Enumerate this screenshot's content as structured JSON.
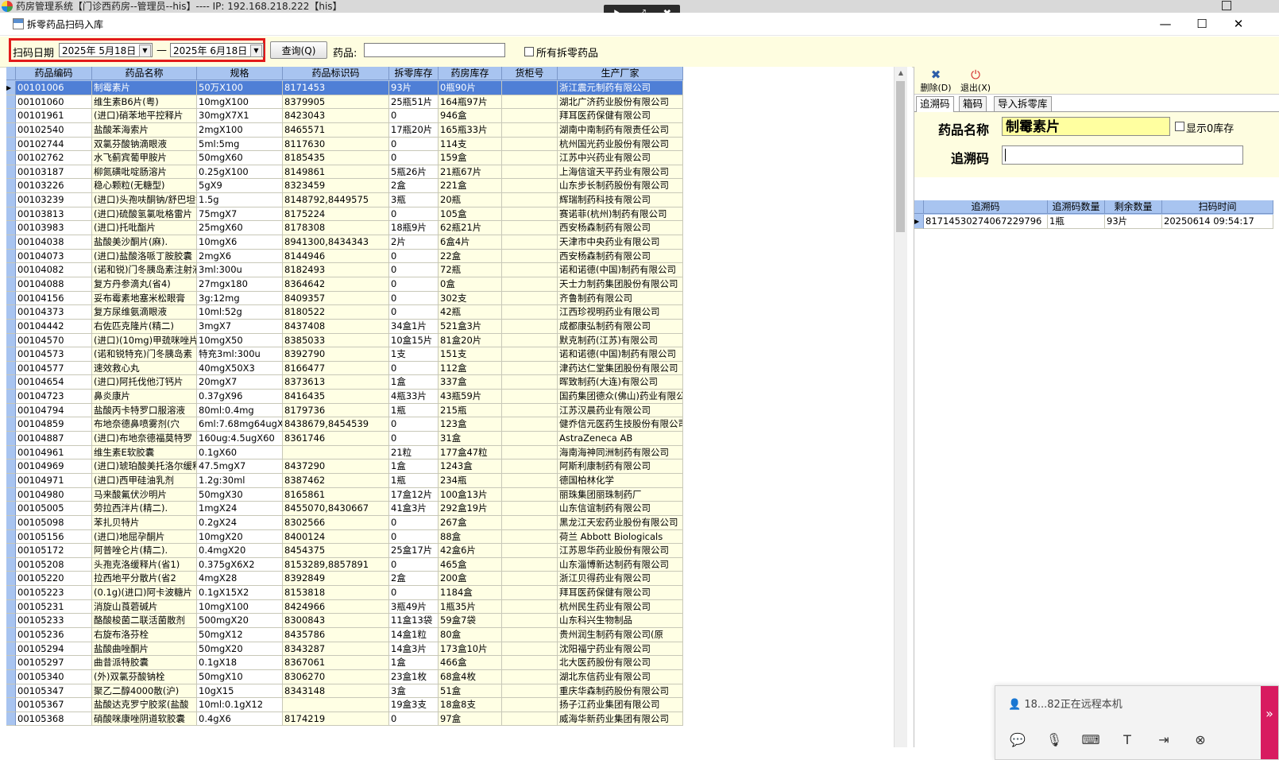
{
  "app": {
    "bg_title": "药房管理系统【门诊西药房--管理员--his】---- IP: 192.168.218.222【his】",
    "window_title": "拆零药品扫码入库",
    "controls": {
      "minimize": "—",
      "maximize": "☐",
      "close": "✕"
    }
  },
  "remote_toolbar": [
    "⯈",
    "⤢",
    "✖"
  ],
  "toolbar": {
    "scan_date_label": "扫码日期",
    "date_from": "2025年 5月18日",
    "dash": "—",
    "date_to": "2025年 6月18日",
    "query_button": "查询(Q)",
    "drug_label": "药品:",
    "drug_value": "",
    "all_split_label": "所有拆零药品"
  },
  "grid": {
    "columns": [
      "药品编码",
      "药品名称",
      "规格",
      "药品标识码",
      "拆零库存",
      "药房库存",
      "货柜号",
      "生产厂家"
    ],
    "rows": [
      [
        "00101006",
        "制霉素片",
        "50万X100",
        "8171453",
        "93片",
        "0瓶90片",
        "",
        "浙江震元制药有限公司"
      ],
      [
        "00101060",
        "维生素B6片(粤)",
        "10mgX100",
        "8379905",
        "25瓶51片",
        "164瓶97片",
        "",
        "湖北广济药业股份有限公司"
      ],
      [
        "00101961",
        "(进口)硝苯地平控释片",
        "30mgX7X1",
        "8423043",
        "0",
        "946盒",
        "",
        "拜耳医药保健有限公司"
      ],
      [
        "00102540",
        "盐酸苯海索片",
        "2mgX100",
        "8465571",
        "17瓶20片",
        "165瓶33片",
        "",
        "湖南中南制药有限责任公司"
      ],
      [
        "00102744",
        "双氯芬酸钠滴眼液",
        "5ml:5mg",
        "8117630",
        "0",
        "114支",
        "",
        "杭州国光药业股份有限公司"
      ],
      [
        "00102762",
        "水飞蓟宾葡甲胺片",
        "50mgX60",
        "8185435",
        "0",
        "159盒",
        "",
        "江苏中兴药业有限公司"
      ],
      [
        "00103187",
        "柳氮磺吡啶肠溶片",
        "0.25gX100",
        "8149861",
        "5瓶26片",
        "21瓶67片",
        "",
        "上海信谊天平药业有限公司"
      ],
      [
        "00103226",
        "稳心颗粒(无糖型)",
        "5gX9",
        "8323459",
        "2盒",
        "221盒",
        "",
        "山东步长制药股份有限公司"
      ],
      [
        "00103239",
        "(进口)头孢呋酮钠/舒巴坦钠",
        "1.5g",
        "8148792,8449575",
        "3瓶",
        "20瓶",
        "",
        "辉瑞制药科技有限公司"
      ],
      [
        "00103813",
        "(进口)硫酸氢氯吡格雷片",
        "75mgX7",
        "8175224",
        "0",
        "105盒",
        "",
        "赛诺菲(杭州)制药有限公司"
      ],
      [
        "00103983",
        "(进口)托吡酯片",
        "25mgX60",
        "8178308",
        "18瓶9片",
        "62瓶21片",
        "",
        "西安杨森制药有限公司"
      ],
      [
        "00104038",
        "盐酸美沙酮片(麻).",
        "10mgX6",
        "8941300,8434343",
        "2片",
        "6盒4片",
        "",
        "天津市中央药业有限公司"
      ],
      [
        "00104073",
        "(进口)盐酸洛哌丁胺胶囊",
        "2mgX6",
        "8144946",
        "0",
        "22盒",
        "",
        "西安杨森制药有限公司"
      ],
      [
        "00104082",
        "(诺和锐)门冬胰岛素注射液",
        "3ml:300u",
        "8182493",
        "0",
        "72瓶",
        "",
        "诺和诺德(中国)制药有限公司"
      ],
      [
        "00104088",
        "复方丹参滴丸(省4)",
        "27mgx180",
        "8364642",
        "0",
        "0盒",
        "",
        "天士力制药集团股份有限公司"
      ],
      [
        "00104156",
        "妥布霉素地塞米松眼膏",
        "3g:12mg",
        "8409357",
        "0",
        "302支",
        "",
        "齐鲁制药有限公司"
      ],
      [
        "00104373",
        "复方尿维氨滴眼液",
        "10ml:52g",
        "8180522",
        "0",
        "42瓶",
        "",
        "江西珍视明药业有限公司"
      ],
      [
        "00104442",
        "右佐匹克隆片(精二)",
        "3mgX7",
        "8437408",
        "34盒1片",
        "521盒3片",
        "",
        "成都康弘制药有限公司"
      ],
      [
        "00104570",
        "(进口)(10mg)甲巯咪唑片",
        "10mgX50",
        "8385033",
        "10盒15片",
        "81盒20片",
        "",
        "默克制药(江苏)有限公司"
      ],
      [
        "00104573",
        "(诺和锐特充)门冬胰岛素",
        "特充3ml:300u",
        "8392790",
        "1支",
        "151支",
        "",
        "诺和诺德(中国)制药有限公司"
      ],
      [
        "00104577",
        "速效救心丸",
        "40mgX50X3",
        "8166477",
        "0",
        "112盒",
        "",
        "津药达仁堂集团股份有限公司"
      ],
      [
        "00104654",
        "(进口)阿托伐他汀钙片",
        "20mgX7",
        "8373613",
        "1盒",
        "337盒",
        "",
        "晖致制药(大连)有限公司"
      ],
      [
        "00104723",
        "鼻炎康片",
        "0.37gX96",
        "8416435",
        "4瓶33片",
        "43瓶59片",
        "",
        "国药集团德众(佛山)药业有限公司"
      ],
      [
        "00104794",
        "盐酸丙卡特罗口服溶液",
        "80ml:0.4mg",
        "8179736",
        "1瓶",
        "215瓶",
        "",
        "江苏汉晨药业有限公司"
      ],
      [
        "00104859",
        "布地奈德鼻喷雾剂(穴",
        "6ml:7.68mg64ugX1",
        "8438679,8454539",
        "0",
        "123盒",
        "",
        "健乔信元医药生技股份有限公司"
      ],
      [
        "00104887",
        "(进口)布地奈德福莫特罗",
        "160ug:4.5ugX60",
        "8361746",
        "0",
        "31盒",
        "",
        "AstraZeneca AB"
      ],
      [
        "00104961",
        "维生素E软胶囊",
        "0.1gX60",
        "",
        "21粒",
        "177盒47粒",
        "",
        "海南海神同洲制药有限公司"
      ],
      [
        "00104969",
        "(进口)琥珀酸美托洛尔缓释片",
        "47.5mgX7",
        "8437290",
        "1盒",
        "1243盒",
        "",
        "阿斯利康制药有限公司"
      ],
      [
        "00104971",
        "(进口)西甲硅油乳剂",
        "1.2g:30ml",
        "8387462",
        "1瓶",
        "234瓶",
        "",
        "德国柏林化学"
      ],
      [
        "00104980",
        "马来酸氟伏沙明片",
        "50mgX30",
        "8165861",
        "17盒12片",
        "100盒13片",
        "",
        "丽珠集团丽珠制药厂"
      ],
      [
        "00105005",
        "劳拉西泮片(精二).",
        "1mgX24",
        "8455070,8430667",
        "41盒3片",
        "292盒19片",
        "",
        "山东信谊制药有限公司"
      ],
      [
        "00105098",
        "苯扎贝特片",
        "0.2gX24",
        "8302566",
        "0",
        "267盒",
        "",
        "黑龙江天宏药业股份有限公司"
      ],
      [
        "00105156",
        "(进口)地屈孕酮片",
        "10mgX20",
        "8400124",
        "0",
        "88盒",
        "",
        "荷兰 Abbott Biologicals"
      ],
      [
        "00105172",
        "阿普唑仑片(精二).",
        "0.4mgX20",
        "8454375",
        "25盒17片",
        "42盒6片",
        "",
        "江苏恩华药业股份有限公司"
      ],
      [
        "00105208",
        "头孢克洛缓释片(省1)",
        "0.375gX6X2",
        "8153289,8857891",
        "0",
        "465盒",
        "",
        "山东淄博新达制药有限公司"
      ],
      [
        "00105220",
        "拉西地平分散片(省2",
        "4mgX28",
        "8392849",
        "2盒",
        "200盒",
        "",
        "浙江贝得药业有限公司"
      ],
      [
        "00105223",
        "(0.1g)(进口)阿卡波糖片",
        "0.1gX15X2",
        "8153818",
        "0",
        "1184盒",
        "",
        "拜耳医药保健有限公司"
      ],
      [
        "00105231",
        "消旋山莨菪碱片",
        "10mgX100",
        "8424966",
        "3瓶49片",
        "1瓶35片",
        "",
        "杭州民生药业有限公司"
      ],
      [
        "00105233",
        "酪酸梭菌二联活菌散剂",
        "500mgX20",
        "8300843",
        "11盒13袋",
        "59盒7袋",
        "",
        "山东科兴生物制品"
      ],
      [
        "00105236",
        "右旋布洛芬栓",
        "50mgX12",
        "8435786",
        "14盒1粒",
        "80盒",
        "",
        "贵州润生制药有限公司(原"
      ],
      [
        "00105294",
        "盐酸曲唑酮片",
        "50mgX20",
        "8343287",
        "14盒3片",
        "173盒10片",
        "",
        "沈阳福宁药业有限公司"
      ],
      [
        "00105297",
        "曲昔派特胶囊",
        "0.1gX18",
        "8367061",
        "1盒",
        "466盒",
        "",
        "北大医药股份有限公司"
      ],
      [
        "00105340",
        "(外)双氯芬酸钠栓",
        "50mgX10",
        "8306270",
        "23盒1枚",
        "68盒4枚",
        "",
        "湖北东信药业有限公司"
      ],
      [
        "00105347",
        "聚乙二醇4000散(沪)",
        "10gX15",
        "8343148",
        "3盒",
        "51盒",
        "",
        "重庆华森制药股份有限公司"
      ],
      [
        "00105367",
        "盐酸达克罗宁胶浆(盐酸",
        "10ml:0.1gX12",
        "",
        "19盒3支",
        "18盒8支",
        "",
        "扬子江药业集团有限公司"
      ],
      [
        "00105368",
        "硝酸咪康唑阴道软胶囊",
        "0.4gX6",
        "8174219",
        "0",
        "97盒",
        "",
        "威海华新药业集团有限公司"
      ]
    ]
  },
  "right_panel": {
    "delete_button": "删除(D)",
    "exit_button": "退出(X)",
    "tabs": [
      "追溯码",
      "箱码",
      "导入拆零库"
    ],
    "drug_name_label": "药品名称",
    "drug_name_value": "制霉素片",
    "show_zero_label": "显示0库存",
    "trace_label": "追溯码",
    "trace_value": "",
    "trace_grid": {
      "columns": [
        "追溯码",
        "追溯码数量",
        "剩余数量",
        "扫码时间"
      ],
      "rows": [
        [
          "81714530274067229796",
          "1瓶",
          "93片",
          "20250614 09:54:17"
        ]
      ]
    }
  },
  "remote_popup": {
    "message": "18...82正在远程本机",
    "icons": [
      "chat-icon",
      "mic-icon",
      "keyboard-icon",
      "text-icon",
      "transfer-icon",
      "close-icon"
    ]
  },
  "colors": {
    "toolbar_bg": "#fefde0",
    "header_bg": "#a8c4f0",
    "selected_row": "#4f7fd6",
    "alt_col_bg": "#ffffe4",
    "highlight_box": "#e21b1b",
    "name_field_bg": "#ffffa0"
  }
}
